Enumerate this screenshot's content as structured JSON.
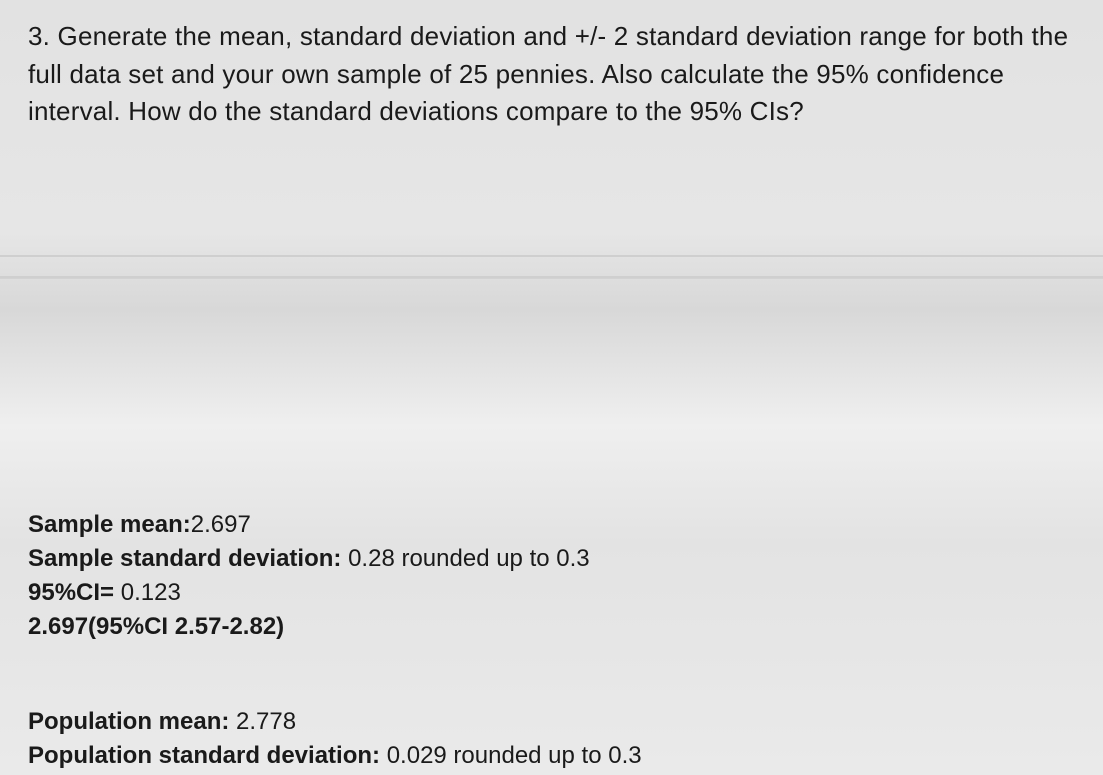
{
  "question": {
    "number": "3.",
    "text": "Generate the mean, standard deviation and +/- 2 standard deviation range for both the full data set  and your own sample of 25 pennies. Also calculate the 95% confidence interval. How do the standard  deviations compare to the 95% CIs?"
  },
  "sample": {
    "mean_label": "Sample mean:",
    "mean_value": "2.697",
    "sd_label": "Sample standard deviation:",
    "sd_value": "0.28 rounded up to  0.3",
    "ci_label": "95%CI=",
    "ci_value": "0.123",
    "ci_range": "2.697(95%CI 2.57-2.82)"
  },
  "population": {
    "mean_label": "Population mean:",
    "mean_value": "2.778",
    "sd_label": "Population standard deviation:",
    "sd_value": "0.029 rounded up to 0.3"
  }
}
